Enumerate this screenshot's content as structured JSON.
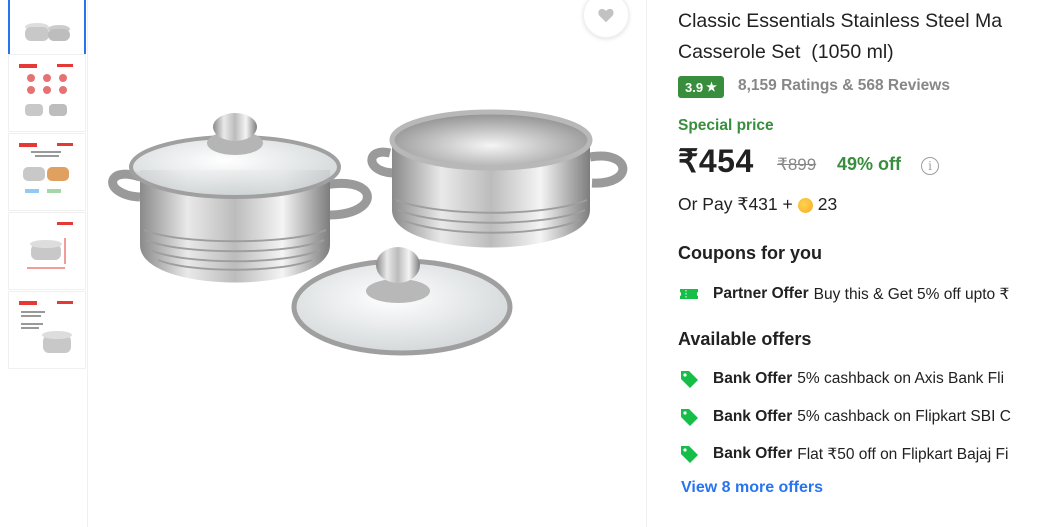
{
  "product": {
    "title_line1": "Classic Essentials Stainless Steel Ma",
    "title_line2": "Casserole Set  (1050 ml)",
    "rating": "3.9",
    "rating_star": "★",
    "ratings_reviews": "8,159 Ratings & 568 Reviews",
    "special_label": "Special price",
    "price": "₹454",
    "mrp": "₹899",
    "discount": "49% off",
    "info_glyph": "i",
    "or_pay_prefix": "Or Pay ₹431 +",
    "or_pay_coins": "23"
  },
  "coupons": {
    "heading": "Coupons for you",
    "items": [
      {
        "kind": "Partner Offer",
        "text": "Buy this & Get 5% off upto ₹"
      }
    ]
  },
  "offers": {
    "heading": "Available offers",
    "items": [
      {
        "kind": "Bank Offer",
        "text": "5% cashback on Axis Bank Fli"
      },
      {
        "kind": "Bank Offer",
        "text": "5% cashback on Flipkart SBI C"
      },
      {
        "kind": "Bank Offer",
        "text": "Flat ₹50 off on Flipkart Bajaj Fi"
      }
    ],
    "view_more": "View 8 more offers"
  },
  "icons": {
    "wishlist": "heart-icon",
    "coupon": "ticket-icon",
    "offer": "tag-icon",
    "coin": "supercoin-icon"
  },
  "colors": {
    "brand_blue": "#2874f0",
    "green": "#388e3c",
    "offer_tag_green": "#14be47",
    "muted_text": "#878787"
  }
}
